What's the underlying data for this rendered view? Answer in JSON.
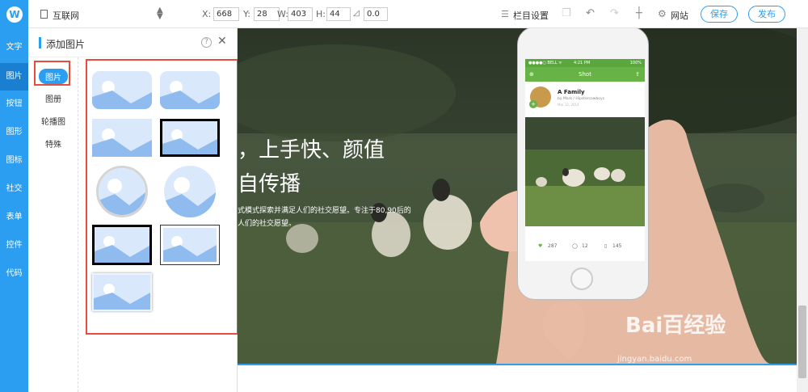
{
  "left_rail": {
    "logo": "W",
    "items": [
      {
        "label": "文字"
      },
      {
        "label": "图片"
      },
      {
        "label": "按钮"
      },
      {
        "label": "图形"
      },
      {
        "label": "图标"
      },
      {
        "label": "社交"
      },
      {
        "label": "表单"
      },
      {
        "label": "控件"
      },
      {
        "label": "代码"
      }
    ],
    "active_index": 1
  },
  "toolbar": {
    "site_name": "互联网",
    "x_label": "X:",
    "x_value": "668",
    "y_label": "Y:",
    "y_value": "28",
    "w_label": "W:",
    "w_value": "403",
    "h_label": "H:",
    "h_value": "44",
    "angle_value": "0.0",
    "column_settings_label": "栏目设置",
    "website_label": "网站",
    "save_label": "保存",
    "publish_label": "发布"
  },
  "panel": {
    "title": "添加图片",
    "help_glyph": "?",
    "close_glyph": "✕",
    "categories": [
      {
        "label": "图片"
      },
      {
        "label": "图册"
      },
      {
        "label": "轮播图"
      },
      {
        "label": "特殊"
      }
    ],
    "active_category_index": 0,
    "thumbnail_styles": [
      "rounded",
      "rounded-wide",
      "plain",
      "thick-border",
      "circle-ring",
      "circle",
      "thick-border",
      "thin-border",
      "shadow"
    ]
  },
  "canvas": {
    "headline_line1": "，上手快、颜值",
    "headline_line2": "自传播",
    "body_line1": "式模式探索并满足人们的社交愿望。专注于80,90后的",
    "body_line2": "人们的社交愿望。",
    "phone": {
      "status_carrier": "●●●●○ BELL ᯤ",
      "status_time": "4:21 PM",
      "status_battery": "100%",
      "app_title": "Shot",
      "post_title": "A Family",
      "post_by": "by Mark / Hipstercowboys",
      "post_date": "Mar 12, 2014",
      "likes": "287",
      "comments": "12",
      "trash": "145"
    },
    "watermark_brand": "Bai百经验",
    "watermark_url": "jingyan.baidu.com"
  },
  "colors": {
    "accent": "#2b9ef2",
    "highlight_red": "#e74c3c",
    "placeholder_light": "#d9e9fb",
    "placeholder_mid": "#8fbbef",
    "phone_green": "#67b346"
  }
}
